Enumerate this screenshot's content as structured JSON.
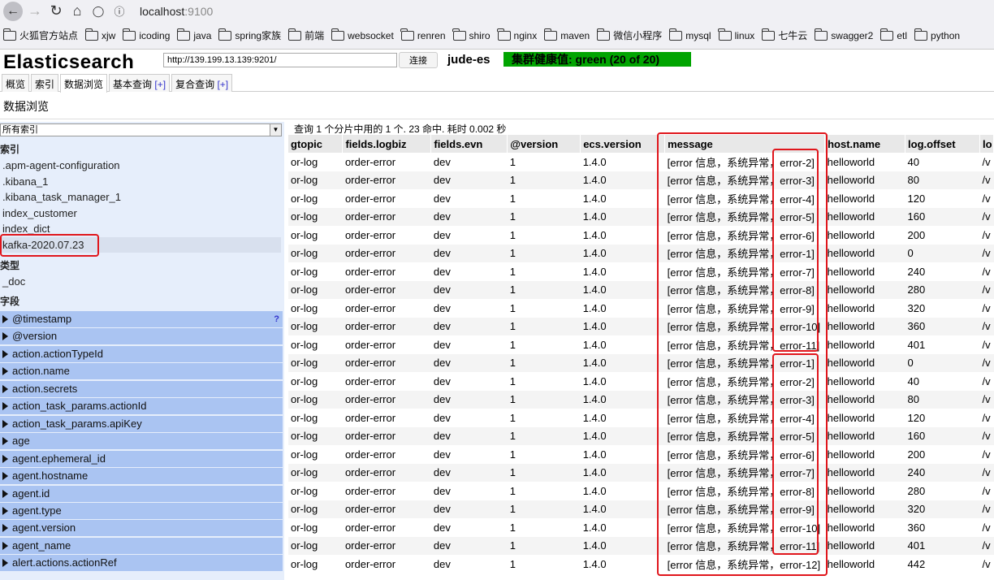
{
  "browser": {
    "url_host": "localhost",
    "url_port": ":9100",
    "bookmarks": [
      "火狐官方站点",
      "xjw",
      "icoding",
      "java",
      "spring家族",
      "前端",
      "websocket",
      "renren",
      "shiro",
      "nginx",
      "maven",
      "微信小程序",
      "mysql",
      "linux",
      "七牛云",
      "swagger2",
      "etl",
      "python"
    ]
  },
  "header": {
    "title": "Elasticsearch",
    "connection_url": "http://139.199.13.139:9201/",
    "connect_label": "连接",
    "cluster_name": "jude-es",
    "health": "集群健康值: green (20 of 20)",
    "health_color": "#00a400"
  },
  "tabs": [
    {
      "label": "概览"
    },
    {
      "label": "索引"
    },
    {
      "label": "数据浏览"
    },
    {
      "label": "基本查询",
      "plus": "[+]"
    },
    {
      "label": "复合查询",
      "plus": "[+]"
    }
  ],
  "page_title": "数据浏览",
  "left": {
    "index_select": "所有索引",
    "indices_heading": "索引",
    "indices": [
      ".apm-agent-configuration",
      ".kibana_1",
      ".kibana_task_manager_1",
      "index_customer",
      "index_dict",
      "kafka-2020.07.23"
    ],
    "types_heading": "类型",
    "types": [
      "_doc"
    ],
    "fields_heading": "字段",
    "fields": [
      "@timestamp",
      "@version",
      "action.actionTypeId",
      "action.name",
      "action.secrets",
      "action_task_params.actionId",
      "action_task_params.apiKey",
      "age",
      "agent.ephemeral_id",
      "agent.hostname",
      "agent.id",
      "agent.type",
      "agent.version",
      "agent_name",
      "alert.actions.actionRef"
    ],
    "help_label": "?"
  },
  "results": {
    "query_info": "查询 1 个分片中用的 1 个. 23 命中. 耗时 0.002 秒",
    "columns": [
      "gtopic",
      "fields.logbiz",
      "fields.evn",
      "@version",
      "ecs.version",
      "message",
      "host.name",
      "log.offset",
      "lo"
    ],
    "rows": [
      [
        "or-log",
        "order-error",
        "dev",
        "1",
        "1.4.0",
        "[error 信息，系统异常，error-2]",
        "helloworld",
        "40",
        "/v"
      ],
      [
        "or-log",
        "order-error",
        "dev",
        "1",
        "1.4.0",
        "[error 信息，系统异常，error-3]",
        "helloworld",
        "80",
        "/v"
      ],
      [
        "or-log",
        "order-error",
        "dev",
        "1",
        "1.4.0",
        "[error 信息，系统异常，error-4]",
        "helloworld",
        "120",
        "/v"
      ],
      [
        "or-log",
        "order-error",
        "dev",
        "1",
        "1.4.0",
        "[error 信息，系统异常，error-5]",
        "helloworld",
        "160",
        "/v"
      ],
      [
        "or-log",
        "order-error",
        "dev",
        "1",
        "1.4.0",
        "[error 信息，系统异常，error-6]",
        "helloworld",
        "200",
        "/v"
      ],
      [
        "or-log",
        "order-error",
        "dev",
        "1",
        "1.4.0",
        "[error 信息，系统异常，error-1]",
        "helloworld",
        "0",
        "/v"
      ],
      [
        "or-log",
        "order-error",
        "dev",
        "1",
        "1.4.0",
        "[error 信息，系统异常，error-7]",
        "helloworld",
        "240",
        "/v"
      ],
      [
        "or-log",
        "order-error",
        "dev",
        "1",
        "1.4.0",
        "[error 信息，系统异常，error-8]",
        "helloworld",
        "280",
        "/v"
      ],
      [
        "or-log",
        "order-error",
        "dev",
        "1",
        "1.4.0",
        "[error 信息，系统异常，error-9]",
        "helloworld",
        "320",
        "/v"
      ],
      [
        "or-log",
        "order-error",
        "dev",
        "1",
        "1.4.0",
        "[error 信息，系统异常，error-10]",
        "helloworld",
        "360",
        "/v"
      ],
      [
        "or-log",
        "order-error",
        "dev",
        "1",
        "1.4.0",
        "[error 信息，系统异常，error-11]",
        "helloworld",
        "401",
        "/v"
      ],
      [
        "or-log",
        "order-error",
        "dev",
        "1",
        "1.4.0",
        "[error 信息，系统异常，error-1]",
        "helloworld",
        "0",
        "/v"
      ],
      [
        "or-log",
        "order-error",
        "dev",
        "1",
        "1.4.0",
        "[error 信息，系统异常，error-2]",
        "helloworld",
        "40",
        "/v"
      ],
      [
        "or-log",
        "order-error",
        "dev",
        "1",
        "1.4.0",
        "[error 信息，系统异常，error-3]",
        "helloworld",
        "80",
        "/v"
      ],
      [
        "or-log",
        "order-error",
        "dev",
        "1",
        "1.4.0",
        "[error 信息，系统异常，error-4]",
        "helloworld",
        "120",
        "/v"
      ],
      [
        "or-log",
        "order-error",
        "dev",
        "1",
        "1.4.0",
        "[error 信息，系统异常，error-5]",
        "helloworld",
        "160",
        "/v"
      ],
      [
        "or-log",
        "order-error",
        "dev",
        "1",
        "1.4.0",
        "[error 信息，系统异常，error-6]",
        "helloworld",
        "200",
        "/v"
      ],
      [
        "or-log",
        "order-error",
        "dev",
        "1",
        "1.4.0",
        "[error 信息，系统异常，error-7]",
        "helloworld",
        "240",
        "/v"
      ],
      [
        "or-log",
        "order-error",
        "dev",
        "1",
        "1.4.0",
        "[error 信息，系统异常，error-8]",
        "helloworld",
        "280",
        "/v"
      ],
      [
        "or-log",
        "order-error",
        "dev",
        "1",
        "1.4.0",
        "[error 信息，系统异常，error-9]",
        "helloworld",
        "320",
        "/v"
      ],
      [
        "or-log",
        "order-error",
        "dev",
        "1",
        "1.4.0",
        "[error 信息，系统异常，error-10]",
        "helloworld",
        "360",
        "/v"
      ],
      [
        "or-log",
        "order-error",
        "dev",
        "1",
        "1.4.0",
        "[error 信息，系统异常，error-11]",
        "helloworld",
        "401",
        "/v"
      ],
      [
        "or-log",
        "order-error",
        "dev",
        "1",
        "1.4.0",
        "[error 信息，系统异常，error-12]",
        "helloworld",
        "442",
        "/v"
      ]
    ]
  },
  "annotation_color": "#e0161c"
}
